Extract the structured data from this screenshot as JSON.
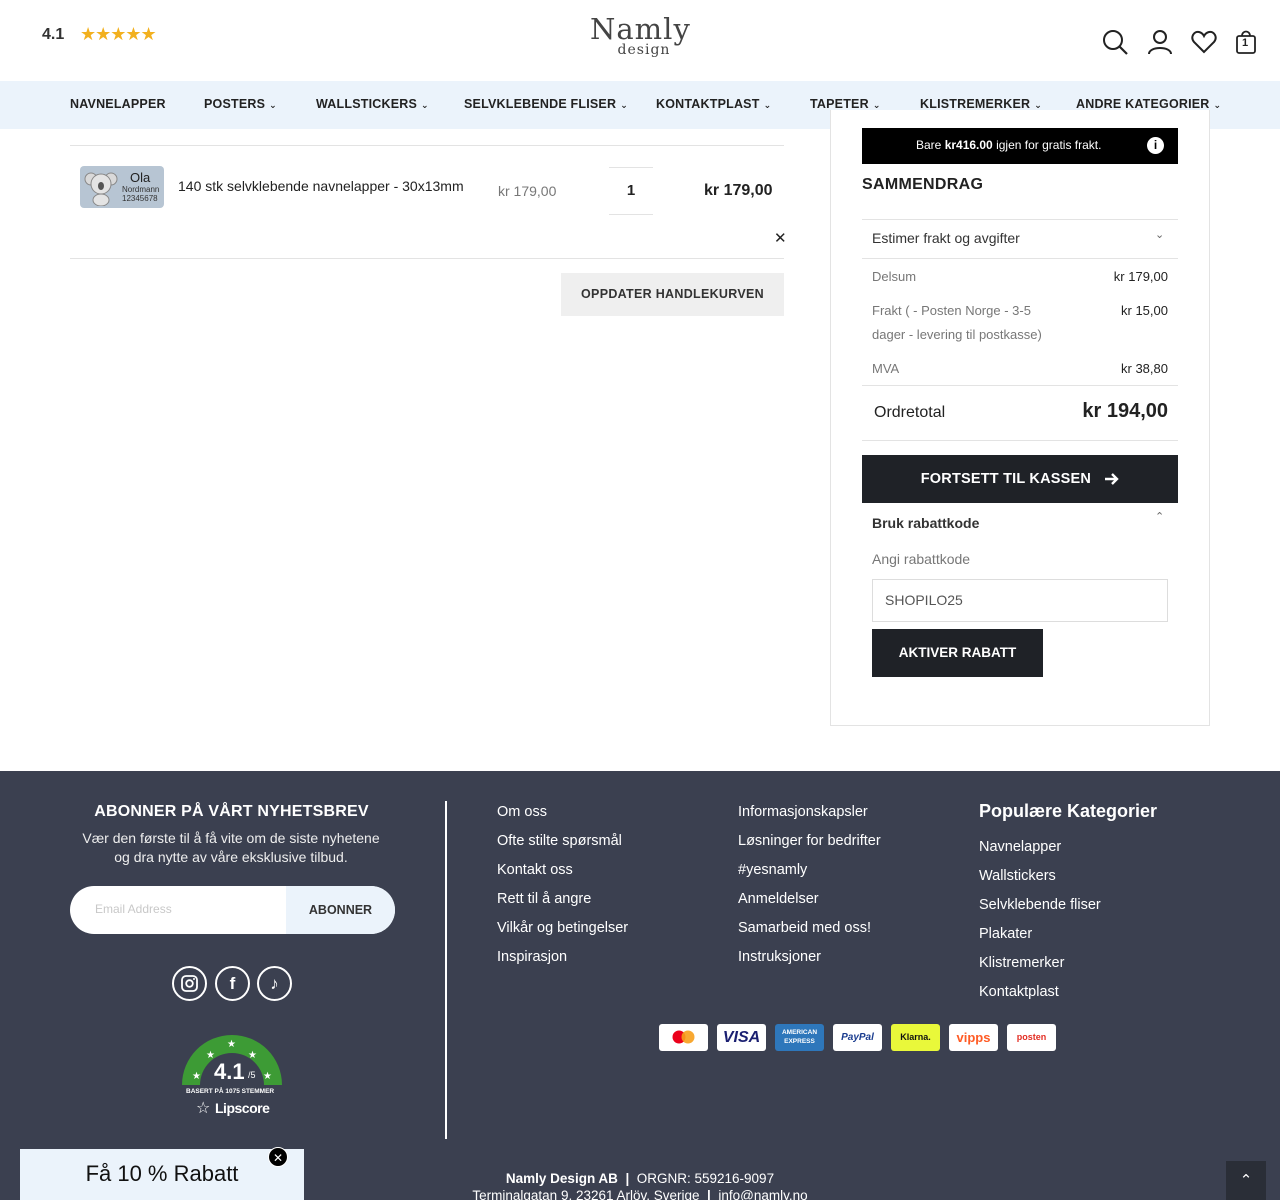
{
  "header": {
    "rating": "4.1",
    "logo_line1": "Namly",
    "logo_line2": "design",
    "cart_count": "1"
  },
  "nav": [
    "NAVNELAPPER",
    "POSTERS",
    "WALLSTICKERS",
    "SELVKLEBENDE FLISER",
    "KONTAKTPLAST",
    "TAPETER",
    "KLISTREMERKER",
    "ANDRE KATEGORIER"
  ],
  "cart": {
    "thumb_name": "Ola",
    "thumb_surname": "Nordmann",
    "thumb_phone": "12345678",
    "item_name": "140 stk selvklebende navnelapper - 30x13mm",
    "item_price": "kr 179,00",
    "qty": "1",
    "item_total": "kr 179,00",
    "update_label": "OPPDATER HANDLEKURVEN"
  },
  "summary": {
    "banner_pre": "Bare ",
    "banner_amount": "kr416.00",
    "banner_post": " igjen for gratis frakt.",
    "title": "SAMMENDRAG",
    "estimate_label": "Estimer frakt og avgifter",
    "subtotal_label": "Delsum",
    "subtotal_value": "kr 179,00",
    "shipping_label_1": "Frakt ( - Posten Norge - 3-5",
    "shipping_label_2": "dager - levering til postkasse)",
    "shipping_value": "kr 15,00",
    "vat_label": "MVA",
    "vat_value": "kr 38,80",
    "total_label": "Ordretotal",
    "total_value": "kr 194,00",
    "checkout_label": "FORTSETT TIL KASSEN",
    "coupon_toggle": "Bruk rabattkode",
    "coupon_label": "Angi rabattkode",
    "coupon_value": "SHOPILO25",
    "apply_label": "AKTIVER RABATT"
  },
  "footer": {
    "nl_title": "ABONNER PÅ VÅRT NYHETSBREV",
    "nl_desc_1": "Vær den første til å få vite om de siste nyhetene",
    "nl_desc_2": "og dra nytte av våre eksklusive tilbud.",
    "email_placeholder": "Email Address",
    "subscribe_label": "ABONNER",
    "lipscore_rating": "4.1",
    "lipscore_scale": "/5",
    "lipscore_votes": "BASERT PÅ 1075 STEMMER",
    "lipscore_brand": "Lipscore",
    "col1": [
      "Om oss",
      "Ofte stilte spørsmål",
      "Kontakt oss",
      "Rett til å angre",
      "Vilkår og betingelser",
      "Inspirasjon"
    ],
    "col2": [
      "Informasjonskapsler",
      "Løsninger for bedrifter",
      "#yesnamly",
      "Anmeldelser",
      "Samarbeid med oss!",
      "Instruksjoner"
    ],
    "cat_title": "Populære Kategorier",
    "col3": [
      "Navnelapper",
      "Wallstickers",
      "Selvklebende fliser",
      "Plakater",
      "Klistremerker",
      "Kontaktplast"
    ],
    "payments": [
      "mastercard",
      "VISA",
      "AMERICAN EXPRESS",
      "PayPal",
      "Klarna.",
      "vipps",
      "posten"
    ],
    "company_name": "Namly Design AB",
    "company_org": "ORGNR: 559216-9097",
    "address": "Terminalgatan 9, 23261 Arlöv, Sverige",
    "email": "info@namly.no"
  },
  "promo": {
    "label": "Få 10 % Rabatt"
  },
  "colors": {
    "nav_bg": "#ebf3fb",
    "footer_bg": "#3b4050",
    "dark_button": "#1f2227",
    "star": "#f2b01e",
    "lipscore_green": "#3d9b35"
  }
}
